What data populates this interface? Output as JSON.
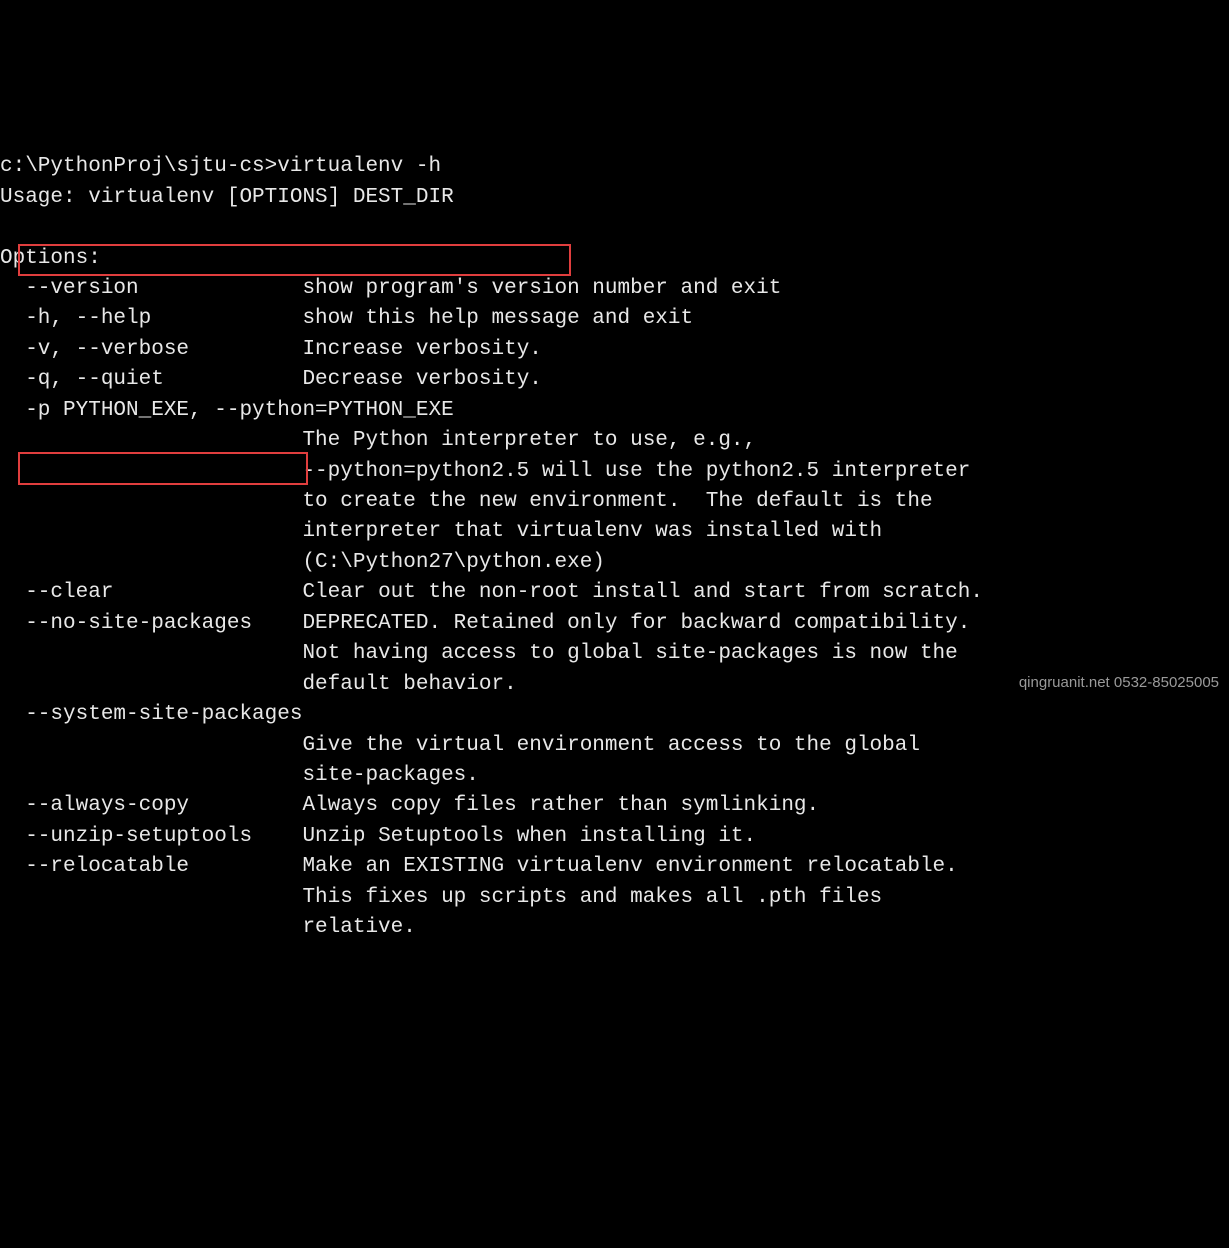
{
  "prompt": "c:\\PythonProj\\sjtu-cs>virtualenv -h",
  "usage": "Usage: virtualenv [OPTIONS] DEST_DIR",
  "options_header": "Options:",
  "options": {
    "version": {
      "flag": "  --version             ",
      "desc": "show program's version number and exit"
    },
    "help": {
      "flag": "  -h, --help            ",
      "desc": "show this help message and exit"
    },
    "verbose": {
      "flag": "  -v, --verbose         ",
      "desc": "Increase verbosity."
    },
    "quiet": {
      "flag": "  -q, --quiet           ",
      "desc": "Decrease verbosity."
    },
    "python": {
      "flag": "  -p PYTHON_EXE, --python=PYTHON_EXE",
      "desc1": "                        The Python interpreter to use, e.g.,",
      "desc2": "                        --python=python2.5 will use the python2.5 interpreter",
      "desc3": "                        to create the new environment.  The default is the",
      "desc4": "                        interpreter that virtualenv was installed with",
      "desc5": "                        (C:\\Python27\\python.exe)"
    },
    "clear": {
      "flag": "  --clear               ",
      "desc": "Clear out the non-root install and start from scratch."
    },
    "nosite": {
      "flag": "  --no-site-packages    ",
      "desc1": "DEPRECATED. Retained only for backward compatibility.",
      "desc2": "                        Not having access to global site-packages is now the",
      "desc3": "                        default behavior."
    },
    "syssite": {
      "flag": "  --system-site-packages",
      "desc1": "                        Give the virtual environment access to the global",
      "desc2": "                        site-packages."
    },
    "always": {
      "flag": "  --always-copy         ",
      "desc": "Always copy files rather than symlinking."
    },
    "unzip": {
      "flag": "  --unzip-setuptools    ",
      "desc": "Unzip Setuptools when installing it."
    },
    "reloc": {
      "flag": "  --relocatable         ",
      "desc1": "Make an EXISTING virtualenv environment relocatable.",
      "desc2": "                        This fixes up scripts and makes all .pth files",
      "desc3": "                        relative."
    }
  },
  "watermark": "qingruanit.net 0532-85025005"
}
